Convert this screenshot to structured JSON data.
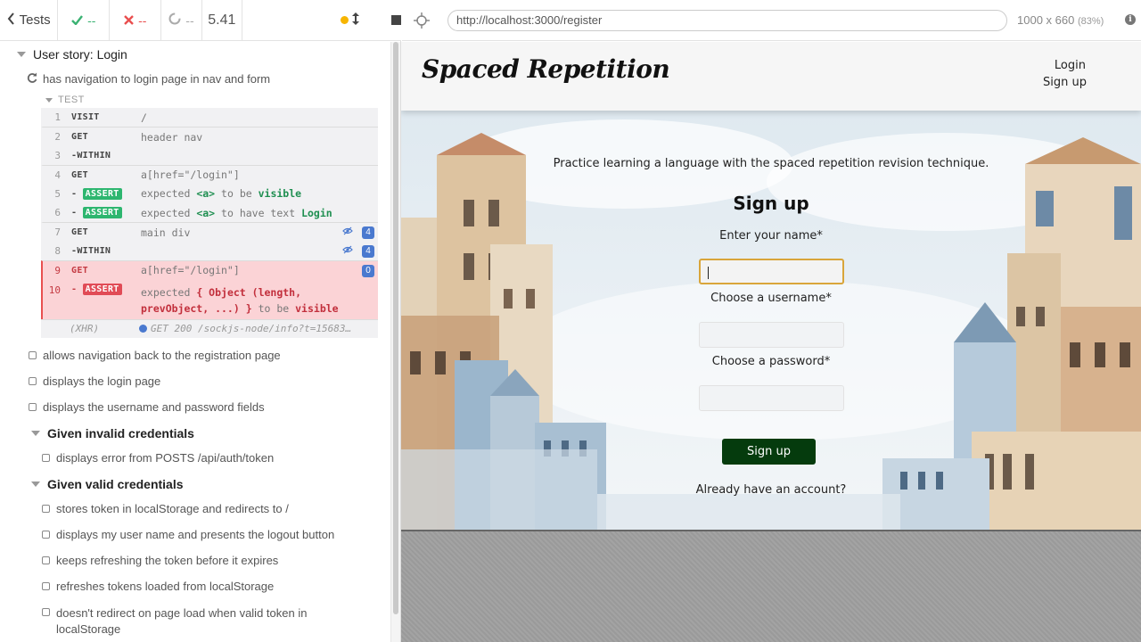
{
  "reporter": {
    "back_label": "Tests",
    "passed": "--",
    "failed": "--",
    "pending": "--",
    "duration": "5.41",
    "suite": "User story: Login",
    "current_test": "has navigation to login page in nav and form",
    "test_section_label": "TEST",
    "commands": [
      {
        "num": "1",
        "name": "VISIT",
        "msg": "/"
      },
      {
        "num": "2",
        "name": "GET",
        "msg": "header nav"
      },
      {
        "num": "3",
        "name": "-WITHIN",
        "msg": ""
      },
      {
        "num": "4",
        "name": "GET",
        "msg": "a[href=\"/login\"]"
      },
      {
        "num": "5",
        "name": "ASSERT",
        "msg_parts": [
          "expected",
          "<a>",
          "to be",
          "visible"
        ]
      },
      {
        "num": "6",
        "name": "ASSERT",
        "msg_parts": [
          "expected",
          "<a>",
          "to have text",
          "Login"
        ]
      },
      {
        "num": "7",
        "name": "GET",
        "msg": "main div",
        "count": "4"
      },
      {
        "num": "8",
        "name": "-WITHIN",
        "msg": "",
        "count": "4"
      },
      {
        "num": "9",
        "name": "GET",
        "msg": "a[href=\"/login\"]",
        "count": "0"
      },
      {
        "num": "10",
        "name": "ASSERT",
        "msg_line1": "{ Object (length,",
        "msg_line2": "prevObject, ...) }",
        "msg_parts": [
          "expected",
          "to be",
          "visible"
        ]
      }
    ],
    "xhr": {
      "label": "(XHR)",
      "msg": "GET 200 /sockjs-node/info?t=15683…"
    },
    "tests": [
      "allows navigation back to the registration page",
      "displays the login page",
      "displays the username and password fields"
    ],
    "sub_suite_invalid": "Given invalid credentials",
    "invalid_tests": [
      "displays error from POSTS /api/auth/token"
    ],
    "sub_suite_valid": "Given valid credentials",
    "valid_tests": [
      "stores token in localStorage and redirects to /",
      "displays my user name and presents the logout button",
      "keeps refreshing the token before it expires",
      "refreshes tokens loaded from localStorage",
      "doesn't redirect on page load when valid token in",
      "localStorage"
    ]
  },
  "aut": {
    "url": "http://localhost:3000/register",
    "viewport": "1000 x 660",
    "zoom": "(83%)",
    "info_icon": "i"
  },
  "site": {
    "logo": "Spaced Repetition",
    "nav_login": "Login",
    "nav_signup": "Sign up",
    "tagline": "Practice learning a language with the spaced repetition revision technique.",
    "form_title": "Sign up",
    "label_name": "Enter your name*",
    "label_username": "Choose a username*",
    "label_password": "Choose a password*",
    "submit": "Sign up",
    "already": "Already have an account?"
  },
  "colors": {
    "pass": "#3bb273",
    "fail": "#e94f4f",
    "button": "#053b0d",
    "focus_border": "#d9a53a"
  }
}
